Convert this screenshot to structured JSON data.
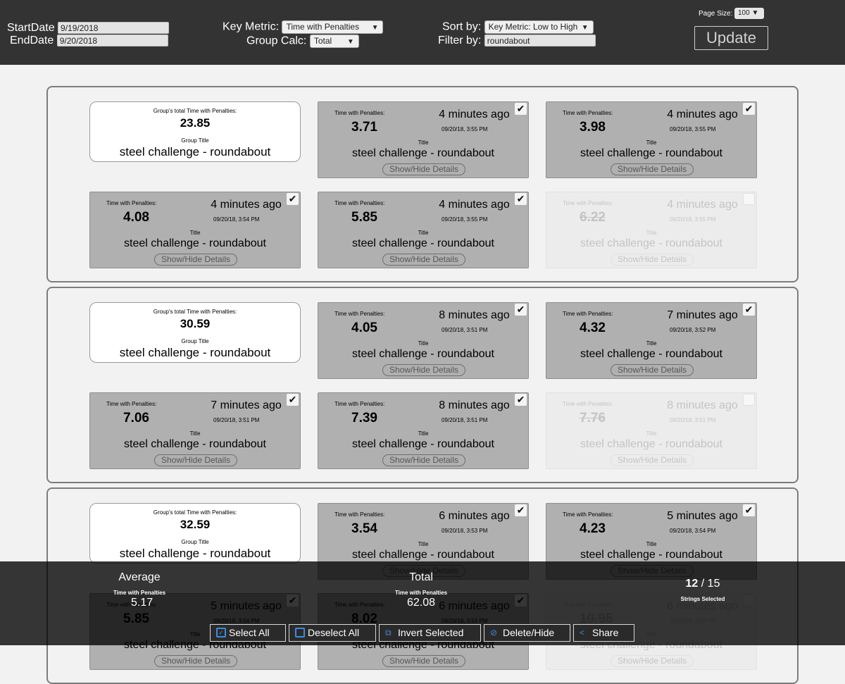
{
  "header": {
    "start_label": "StartDate",
    "start_value": "9/19/2018",
    "end_label": "EndDate",
    "end_value": "9/20/2018",
    "key_metric_label": "Key Metric:",
    "key_metric_value": "Time with Penalties",
    "group_calc_label": "Group Calc:",
    "group_calc_value": "Total",
    "sort_label": "Sort by:",
    "sort_value": "Key Metric: Low to High",
    "filter_label": "Filter by:",
    "filter_value": "roundabout",
    "page_size_label": "Page Size:",
    "page_size_value": "100",
    "update_label": "Update"
  },
  "common": {
    "metric_label": "Time with Penalties:",
    "group_metric_label": "Group's total Time with Penalties:",
    "group_title_label": "Group Title",
    "title_label": "Title",
    "details_label": "Show/Hide Details",
    "check_glyph": "✔"
  },
  "groups": [
    {
      "total": "23.85",
      "title": "steel challenge - roundabout",
      "cards": [
        {
          "value": "3.71",
          "ago": "4 minutes ago",
          "ts": "09/20/18, 3:55 PM",
          "title": "steel challenge - roundabout",
          "selected": true
        },
        {
          "value": "3.98",
          "ago": "4 minutes ago",
          "ts": "09/20/18, 3:55 PM",
          "title": "steel challenge - roundabout",
          "selected": true
        },
        {
          "value": "4.08",
          "ago": "4 minutes ago",
          "ts": "09/20/18, 3:54 PM",
          "title": "steel challenge - roundabout",
          "selected": true
        },
        {
          "value": "5.85",
          "ago": "4 minutes ago",
          "ts": "09/20/18, 3:55 PM",
          "title": "steel challenge - roundabout",
          "selected": true
        },
        {
          "value": "6.22",
          "ago": "4 minutes ago",
          "ts": "09/20/18, 3:55 PM",
          "title": "steel challenge - roundabout",
          "selected": false
        }
      ]
    },
    {
      "total": "30.59",
      "title": "steel challenge - roundabout",
      "cards": [
        {
          "value": "4.05",
          "ago": "8 minutes ago",
          "ts": "09/20/18, 3:51 PM",
          "title": "steel challenge - roundabout",
          "selected": true
        },
        {
          "value": "4.32",
          "ago": "7 minutes ago",
          "ts": "09/20/18, 3:52 PM",
          "title": "steel challenge - roundabout",
          "selected": true
        },
        {
          "value": "7.06",
          "ago": "7 minutes ago",
          "ts": "09/20/18, 3:51 PM",
          "title": "steel challenge - roundabout",
          "selected": true
        },
        {
          "value": "7.39",
          "ago": "8 minutes ago",
          "ts": "09/20/18, 3:51 PM",
          "title": "steel challenge - roundabout",
          "selected": true
        },
        {
          "value": "7.76",
          "ago": "8 minutes ago",
          "ts": "09/20/18, 3:51 PM",
          "title": "steel challenge - roundabout",
          "selected": false
        }
      ]
    },
    {
      "total": "32.59",
      "title": "steel challenge - roundabout",
      "cards": [
        {
          "value": "3.54",
          "ago": "6 minutes ago",
          "ts": "09/20/18, 3:53 PM",
          "title": "steel challenge - roundabout",
          "selected": true
        },
        {
          "value": "4.23",
          "ago": "5 minutes ago",
          "ts": "09/20/18, 3:54 PM",
          "title": "steel challenge - roundabout",
          "selected": true
        },
        {
          "value": "5.85",
          "ago": "5 minutes ago",
          "ts": "09/20/18, 3:54 PM",
          "title": "steel challenge - roundabout",
          "selected": true
        },
        {
          "value": "8.02",
          "ago": "6 minutes ago",
          "ts": "09/20/18, 3:53 PM",
          "title": "steel challenge - roundabout",
          "selected": true
        },
        {
          "value": "10.95",
          "ago": "6 minutes ago",
          "ts": "09/20/18, 3:53 PM",
          "title": "steel challenge - roundabout",
          "selected": false
        }
      ]
    }
  ],
  "summary": {
    "average_label": "Average",
    "average_metric": "Time with Penalties",
    "average_value": "5.17",
    "total_label": "Total",
    "total_metric": "Time with Penalties",
    "total_value": "62.08",
    "selected_count": "12",
    "selected_sep": " / ",
    "total_count": "15",
    "selected_label": "Strings Selected"
  },
  "actions": {
    "select_all": "Select All",
    "deselect_all": "Deselect All",
    "invert": "Invert Selected",
    "delete_hide": "Delete/Hide",
    "share": "Share"
  }
}
